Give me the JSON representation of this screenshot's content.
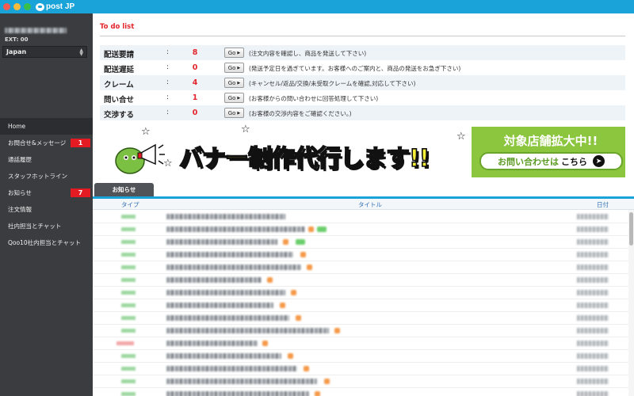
{
  "app": {
    "title": "post JP"
  },
  "sidebar": {
    "ext_label": "EXT: 00",
    "country": "Japan",
    "nav": [
      {
        "label": "Home",
        "active": true
      },
      {
        "label": "お問合せ&メッセージ",
        "badge": "1"
      },
      {
        "label": "通話履歴"
      },
      {
        "label": "スタッフホットライン"
      },
      {
        "label": "お知らせ",
        "badge": "7"
      },
      {
        "label": "注文情報"
      },
      {
        "label": "社内担当とチャット"
      },
      {
        "label": "Qoo10社内担当とチャット"
      }
    ]
  },
  "todo": {
    "title": "To do list",
    "button_label": "Go",
    "rows": [
      {
        "label": "配送要請",
        "colon": ":",
        "count": "8",
        "desc": "(注文内容を確認し、商品を発送して下さい)"
      },
      {
        "label": "配送遅延",
        "colon": ":",
        "count": "0",
        "desc": "(発送予定日を過ぎています。お客様へのご案内と、商品の発送をお急ぎ下さい)"
      },
      {
        "label": "クレーム",
        "colon": ":",
        "count": "4",
        "desc": "(キャンセル/返品/交換/未受取クレームを確認,対応して下さい)"
      },
      {
        "label": "問い合せ",
        "colon": ":",
        "count": "1",
        "desc": "(お客様からの問い合わせに回答処理して下さい)"
      },
      {
        "label": "交渉する",
        "colon": ":",
        "count": "0",
        "desc": "(お客様の交渉内容をご確認ください。)"
      }
    ]
  },
  "banner": {
    "main_text": "バナー制作代行します!!",
    "right_title": "対象店舗拡大中!!",
    "cta_prefix": "お問い合わせは",
    "cta_accent": "こちら",
    "colors": {
      "main_fill": "#f6ef3a",
      "panel": "#8cc63f"
    }
  },
  "notice": {
    "tab_label": "お知らせ",
    "columns": {
      "type": "タイプ",
      "title": "タイトル",
      "date": "日付"
    }
  }
}
